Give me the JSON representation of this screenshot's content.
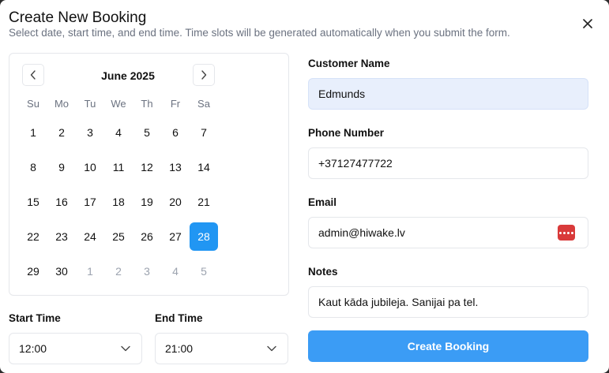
{
  "dialog": {
    "title": "Create New Booking",
    "subtitle": "Select date, start time, and end time. Time slots will be generated automatically when you submit the form."
  },
  "calendar": {
    "month_label": "June 2025",
    "weekdays": [
      "Su",
      "Mo",
      "Tu",
      "We",
      "Th",
      "Fr",
      "Sa"
    ],
    "weeks": [
      [
        {
          "d": "1"
        },
        {
          "d": "2"
        },
        {
          "d": "3"
        },
        {
          "d": "4"
        },
        {
          "d": "5"
        },
        {
          "d": "6"
        },
        {
          "d": "7"
        }
      ],
      [
        {
          "d": "8"
        },
        {
          "d": "9"
        },
        {
          "d": "10"
        },
        {
          "d": "11"
        },
        {
          "d": "12"
        },
        {
          "d": "13"
        },
        {
          "d": "14"
        }
      ],
      [
        {
          "d": "15"
        },
        {
          "d": "16"
        },
        {
          "d": "17"
        },
        {
          "d": "18"
        },
        {
          "d": "19"
        },
        {
          "d": "20"
        },
        {
          "d": "21"
        }
      ],
      [
        {
          "d": "22"
        },
        {
          "d": "23"
        },
        {
          "d": "24"
        },
        {
          "d": "25"
        },
        {
          "d": "26"
        },
        {
          "d": "27"
        },
        {
          "d": "28",
          "selected": true
        }
      ],
      [
        {
          "d": "29"
        },
        {
          "d": "30"
        },
        {
          "d": "1",
          "outside": true
        },
        {
          "d": "2",
          "outside": true
        },
        {
          "d": "3",
          "outside": true
        },
        {
          "d": "4",
          "outside": true
        },
        {
          "d": "5",
          "outside": true
        }
      ]
    ]
  },
  "time": {
    "start_label": "Start Time",
    "start_value": "12:00",
    "end_label": "End Time",
    "end_value": "21:00"
  },
  "form": {
    "name_label": "Customer Name",
    "name_value": "Edmunds",
    "phone_label": "Phone Number",
    "phone_value": "+37127477722",
    "email_label": "Email",
    "email_value": "admin@hiwake.lv",
    "notes_label": "Notes",
    "notes_value": "Kaut kāda jubileja. Sanijai pa tel.",
    "submit_label": "Create Booking"
  },
  "colors": {
    "accent": "#2196f3",
    "button": "#3b9cf5",
    "autofill": "#e8effc",
    "password_badge": "#d93a3a"
  },
  "icons": {
    "close": "close-icon",
    "prev": "chevron-left-icon",
    "next": "chevron-right-icon",
    "dropdown": "chevron-down-icon",
    "password_manager": "password-manager-icon"
  }
}
